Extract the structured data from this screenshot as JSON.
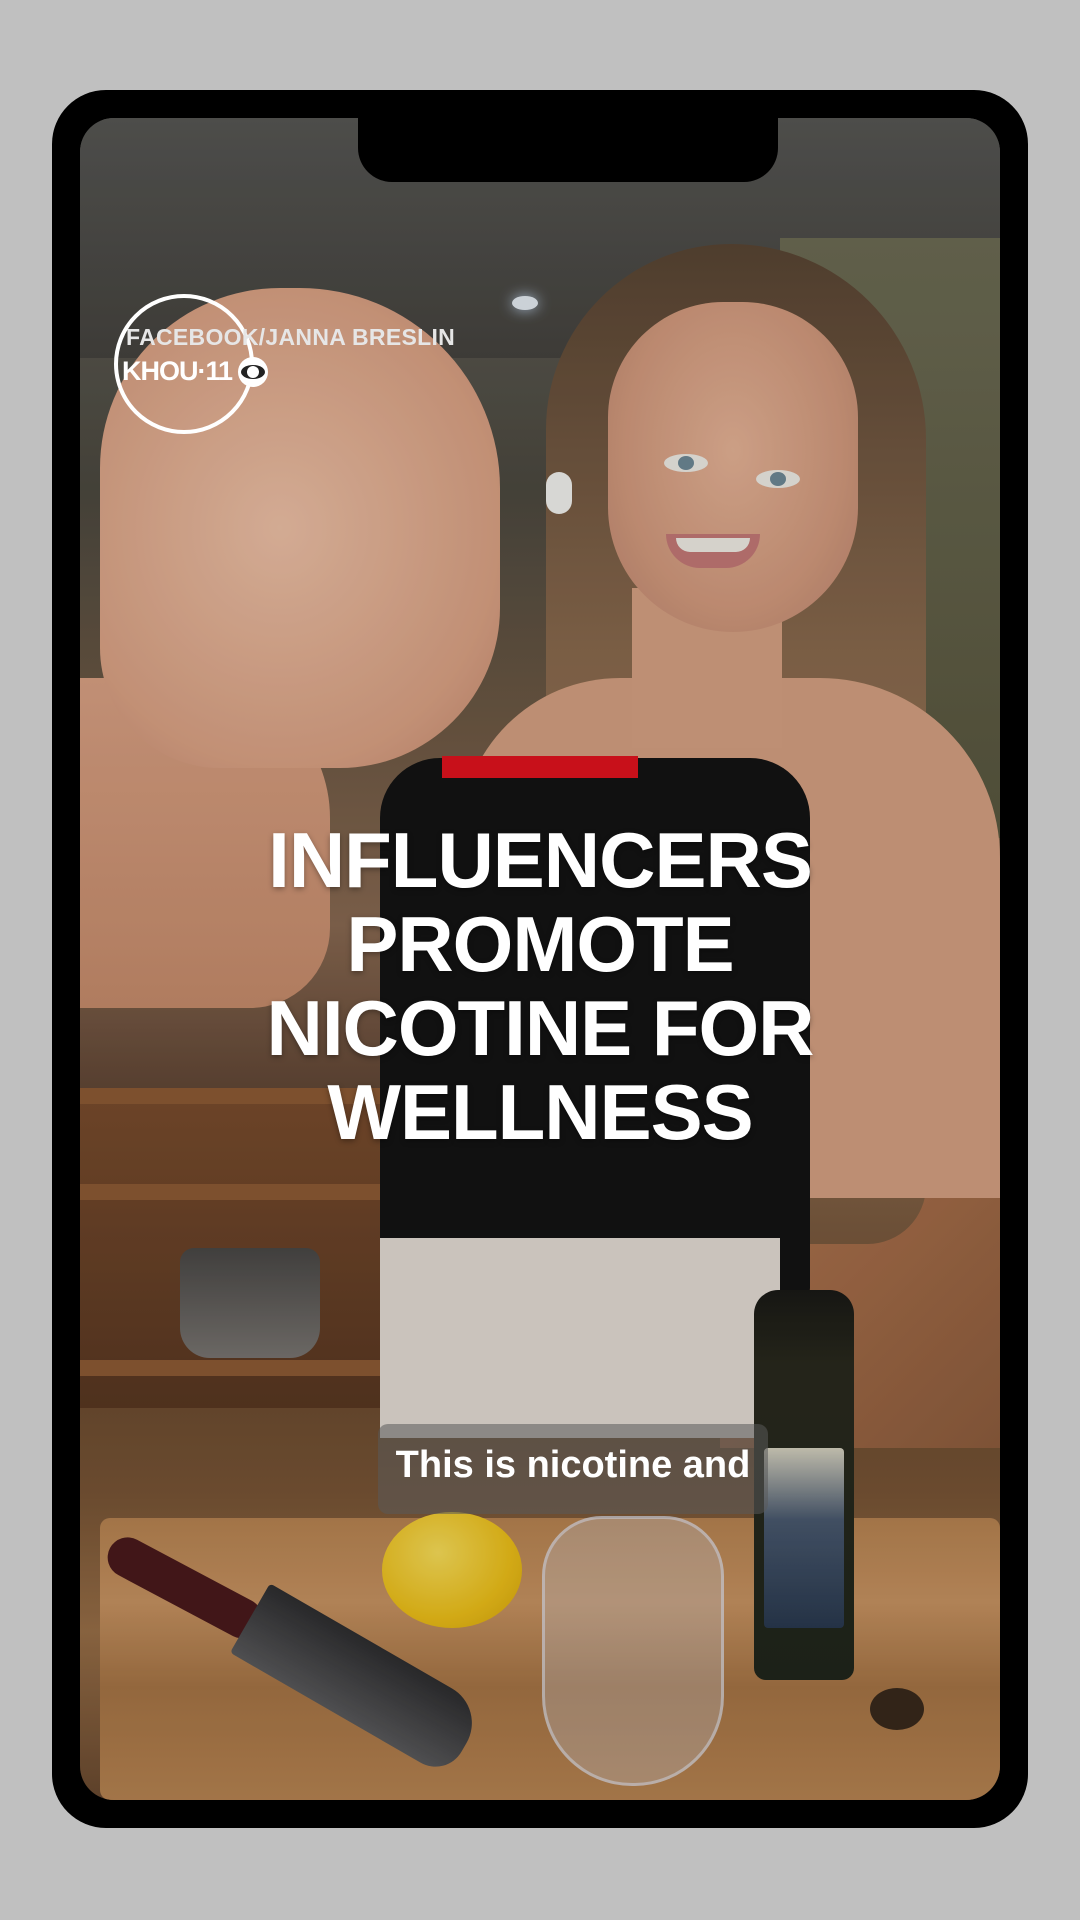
{
  "overlay": {
    "source_credit": "FACEBOOK/JANNA BRESLIN",
    "station_logo": "KHOU·11",
    "network_icon": "cbs-eye-icon"
  },
  "headline": {
    "lines": [
      "INFLUENCERS",
      "PROMOTE",
      "NICOTINE FOR",
      "WELLNESS"
    ]
  },
  "caption": {
    "text": "This is nicotine and"
  },
  "colors": {
    "accent_bar": "#c8101a",
    "frame": "#000000",
    "background": "#c0c0c0"
  }
}
